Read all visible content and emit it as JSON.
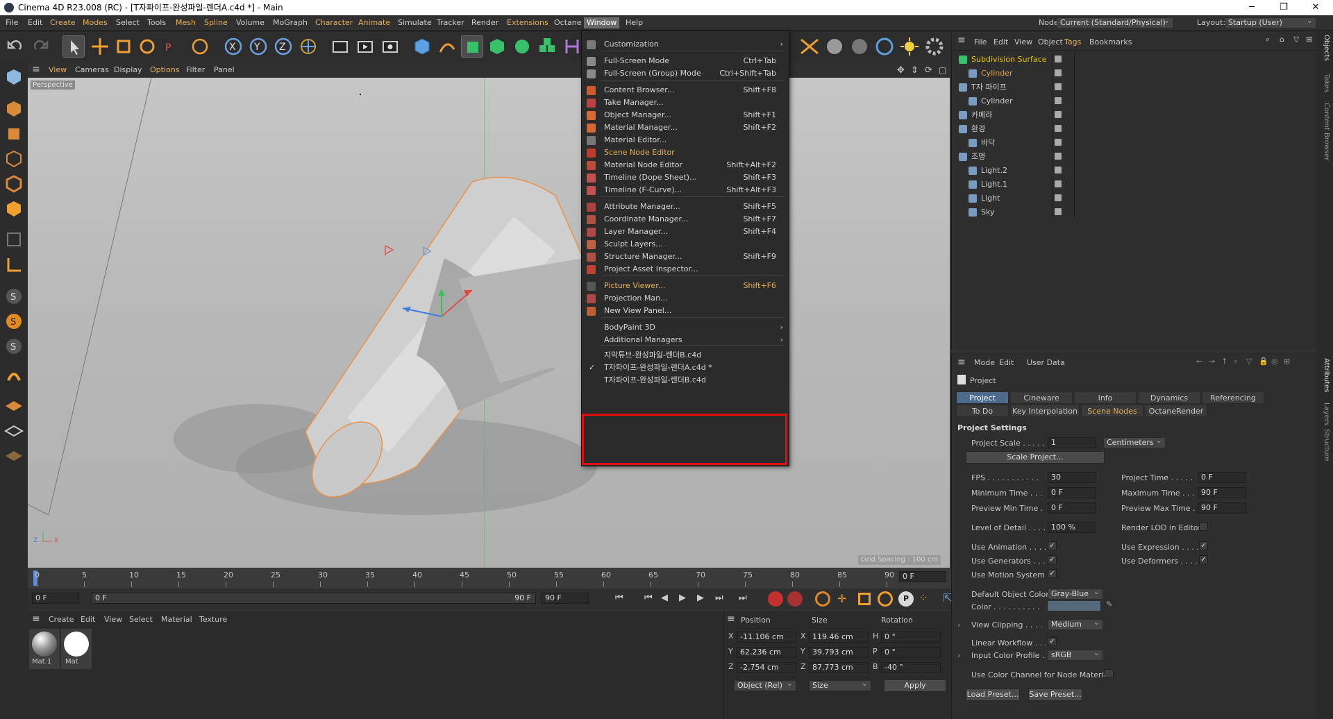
{
  "titlebar": {
    "title": "Cinema 4D R23.008 (RC) - [T자파이프-완성파일-렌더A.c4d *] - Main",
    "minimize": "─",
    "restore": "❐",
    "close": "✕"
  },
  "menubar": {
    "items": [
      "File",
      "Edit",
      "Create",
      "Modes",
      "Select",
      "Tools",
      "Mesh",
      "Spline",
      "Volume",
      "MoGraph",
      "Character",
      "Animate",
      "Simulate",
      "Tracker",
      "Render",
      "Extensions",
      "Octane",
      "Window",
      "Help"
    ],
    "node_space_label": "Node Space:",
    "node_space_value": "Current (Standard/Physical)",
    "layout_label": "Layout:",
    "layout_value": "Startup (User)"
  },
  "viewport": {
    "menu": [
      "View",
      "Cameras",
      "Display",
      "Options",
      "Filter",
      "Panel"
    ],
    "camera_label": "Perspective",
    "grid_spacing": "Grid Spacing : 100 cm",
    "axis": {
      "z": "Z",
      "x": "X"
    }
  },
  "timeline": {
    "ticks": [
      "0",
      "5",
      "10",
      "15",
      "20",
      "25",
      "30",
      "35",
      "40",
      "45",
      "50",
      "55",
      "60",
      "65",
      "70",
      "75",
      "80",
      "85",
      "90"
    ],
    "current_frame": "0 F"
  },
  "transport": {
    "start": "0 F",
    "range_start": "0 F",
    "range_end": "90 F",
    "end": "90 F"
  },
  "material_manager": {
    "menu": [
      "Create",
      "Edit",
      "View",
      "Select",
      "Material",
      "Texture"
    ],
    "materials": [
      {
        "name": "Mat.1"
      },
      {
        "name": "Mat"
      }
    ]
  },
  "coordinates": {
    "headers": [
      "Position",
      "Size",
      "Rotation"
    ],
    "rows": [
      {
        "axis": "X",
        "pos": "-11.106 cm",
        "size_axis": "X",
        "size": "119.46 cm",
        "rot_axis": "H",
        "rot": "0 °"
      },
      {
        "axis": "Y",
        "pos": "62.236 cm",
        "size_axis": "Y",
        "size": "39.793 cm",
        "rot_axis": "P",
        "rot": "0 °"
      },
      {
        "axis": "Z",
        "pos": "-2.754 cm",
        "size_axis": "Z",
        "size": "87.773 cm",
        "rot_axis": "B",
        "rot": "-40 °"
      }
    ],
    "mode": "Object (Rel)",
    "size_mode": "Size",
    "apply": "Apply"
  },
  "object_manager": {
    "menu": [
      "File",
      "Edit",
      "View",
      "Object",
      "Tags",
      "Bookmarks"
    ],
    "objects": [
      {
        "name": "Subdivision Surface",
        "level": 0,
        "color": "#e8c400"
      },
      {
        "name": "Cylinder",
        "level": 1,
        "color": "#e8a040"
      },
      {
        "name": "T자 파이프",
        "level": 0,
        "color": "#cccccc"
      },
      {
        "name": "Cylinder",
        "level": 1,
        "color": "#cccccc"
      },
      {
        "name": "카메라",
        "level": 0,
        "color": "#cccccc"
      },
      {
        "name": "환경",
        "level": 0,
        "color": "#cccccc"
      },
      {
        "name": "바닥",
        "level": 1,
        "color": "#cccccc"
      },
      {
        "name": "조명",
        "level": 0,
        "color": "#cccccc"
      },
      {
        "name": "Light.2",
        "level": 1,
        "color": "#cccccc"
      },
      {
        "name": "Light.1",
        "level": 1,
        "color": "#cccccc"
      },
      {
        "name": "Light",
        "level": 1,
        "color": "#cccccc"
      },
      {
        "name": "Sky",
        "level": 1,
        "color": "#cccccc"
      }
    ]
  },
  "attributes": {
    "menu": [
      "Mode",
      "Edit",
      "User Data"
    ],
    "object": "Project",
    "tabs_row1": [
      "Project Settings",
      "Cineware",
      "Info",
      "Dynamics",
      "Referencing"
    ],
    "tabs_row2": [
      "To Do",
      "Key Interpolation",
      "Scene Nodes",
      "OctaneRender"
    ],
    "section": "Project Settings",
    "project_scale_label": "Project Scale . . . . .",
    "project_scale_value": "1",
    "project_scale_unit": "Centimeters",
    "scale_project": "Scale Project...",
    "fps_label": "FPS . . . . . . . . . . .",
    "fps": "30",
    "project_time_label": "Project Time . . . . .",
    "project_time": "0 F",
    "min_time_label": "Minimum Time . . .",
    "min_time": "0 F",
    "max_time_label": "Maximum Time . . .",
    "max_time": "90 F",
    "prev_min_label": "Preview Min Time .",
    "prev_min": "0 F",
    "prev_max_label": "Preview Max Time .",
    "prev_max": "90 F",
    "lod_label": "Level of Detail . . . .",
    "lod": "100 %",
    "render_lod_label": "Render LOD in Editor",
    "use_animation": "Use Animation . . . .",
    "use_expression": "Use Expression . . . .",
    "use_generators": "Use Generators . . .",
    "use_deformers": "Use Deformers . . . .",
    "use_motion": "Use Motion System",
    "default_color_label": "Default Object Color",
    "default_color": "Gray-Blue",
    "color_label": "Color . . . . . . . . . .",
    "view_clipping_label": "View Clipping . . . .",
    "view_clipping": "Medium",
    "linear_workflow": "Linear Workflow . . .",
    "input_profile_label": "Input Color Profile . .",
    "input_profile": "sRGB",
    "use_color_channel": "Use Color Channel for Node Material",
    "load_preset": "Load Preset...",
    "save_preset": "Save Preset..."
  },
  "right_strip": [
    "Objects",
    "Takes",
    "Content Browser",
    "Attributes",
    "Layers",
    "Structure"
  ],
  "window_menu": {
    "items": [
      {
        "label": "Customization",
        "shortcut": "",
        "arrow": "›",
        "color": "#7a7a7a"
      },
      {
        "label": "Full-Screen Mode",
        "shortcut": "Ctrl+Tab",
        "color": "#8a8a8a"
      },
      {
        "label": "Full-Screen (Group) Mode",
        "shortcut": "Ctrl+Shift+Tab",
        "color": "#8a8a8a"
      },
      {
        "label": "Content Browser...",
        "shortcut": "Shift+F8",
        "color": "#d35a2a"
      },
      {
        "label": "Take Manager...",
        "shortcut": "",
        "color": "#c04040"
      },
      {
        "label": "Object Manager...",
        "shortcut": "Shift+F1",
        "color": "#d66a30"
      },
      {
        "label": "Material Manager...",
        "shortcut": "Shift+F2",
        "color": "#d66a30"
      },
      {
        "label": "Material Editor...",
        "shortcut": "",
        "color": "#777777"
      },
      {
        "label": "Scene Node Editor",
        "shortcut": "",
        "color": "#c23a2a"
      },
      {
        "label": "Material Node Editor",
        "shortcut": "Shift+Alt+F2",
        "color": "#c04a3a"
      },
      {
        "label": "Timeline (Dope Sheet)...",
        "shortcut": "Shift+F3",
        "color": "#c45050"
      },
      {
        "label": "Timeline (F-Curve)...",
        "shortcut": "Shift+Alt+F3",
        "color": "#c45050"
      },
      {
        "label": "Attribute Manager...",
        "shortcut": "Shift+F5",
        "color": "#b04040"
      },
      {
        "label": "Coordinate Manager...",
        "shortcut": "Shift+F7",
        "color": "#b05040"
      },
      {
        "label": "Layer Manager...",
        "shortcut": "Shift+F4",
        "color": "#b04848"
      },
      {
        "label": "Sculpt Layers...",
        "shortcut": "",
        "color": "#c06040"
      },
      {
        "label": "Structure Manager...",
        "shortcut": "Shift+F9",
        "color": "#b05040"
      },
      {
        "label": "Project Asset Inspector...",
        "shortcut": "",
        "color": "#c04030"
      },
      {
        "label": "Picture Viewer...",
        "shortcut": "Shift+F6",
        "color": "#555555"
      },
      {
        "label": "Projection Man...",
        "shortcut": "",
        "color": "#b04848"
      },
      {
        "label": "New View Panel...",
        "shortcut": "",
        "color": "#c06030"
      },
      {
        "label": "BodyPaint 3D",
        "shortcut": "",
        "arrow": "›",
        "color": ""
      },
      {
        "label": "Additional Managers",
        "shortcut": "",
        "arrow": "›",
        "color": ""
      },
      {
        "label": "지악튜브-완성파일-렌더B.c4d",
        "shortcut": "",
        "color": ""
      },
      {
        "label": "T자파이프-완성파일-렌더A.c4d *",
        "shortcut": "",
        "color": "",
        "checked": "✓"
      },
      {
        "label": "T자파이프-완성파일-렌더B.c4d",
        "shortcut": "",
        "color": ""
      }
    ]
  }
}
